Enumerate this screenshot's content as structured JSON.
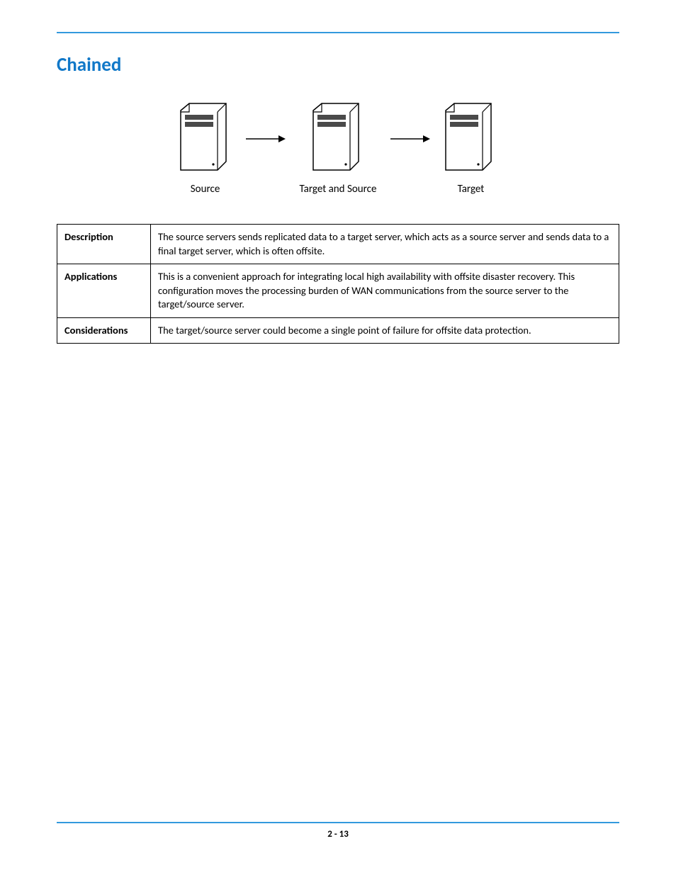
{
  "heading": "Chained",
  "diagram": {
    "server1_label": "Source",
    "server2_label": "Target and Source",
    "server3_label": "Target"
  },
  "table": {
    "rows": [
      {
        "label": "Description",
        "text": "The source servers sends replicated data to a target server, which acts as a source server and sends data to a final target server, which is often offsite."
      },
      {
        "label": "Applications",
        "text": "This is a convenient approach for integrating local high availability with offsite disaster recovery. This configuration moves the processing burden of WAN communications from the source server to the target/source server."
      },
      {
        "label": "Considerations",
        "text": "The target/source server could become a single point of failure for offsite data protection."
      }
    ]
  },
  "page_number": "2 - 13"
}
